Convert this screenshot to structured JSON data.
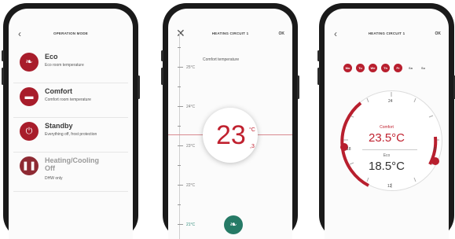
{
  "colors": {
    "accent": "#b81f2e",
    "eco_green": "#267a66",
    "phone_frame": "#1a1a1a"
  },
  "operation_mode": {
    "title": "OPERATION MODE",
    "back_icon": "chevron-left-icon",
    "modes": [
      {
        "name": "Eco",
        "description": "Eco room temperature",
        "icon": "leaf-icon"
      },
      {
        "name": "Comfort",
        "description": "Comfort room temperature",
        "icon": "bed-icon"
      },
      {
        "name": "Standby",
        "description": "Everything off, frost protection",
        "icon": "power-icon"
      },
      {
        "name": "Heating/Cooling Off",
        "description": "DHW only",
        "icon": "pause-icon"
      }
    ]
  },
  "heating_circuit_temp": {
    "title": "HEATING CIRCUIT 1",
    "ok": "OK",
    "close_icon": "close-icon",
    "label": "Comfort temperature",
    "scale": [
      "25°C",
      "24°C",
      "23°C",
      "22°C",
      "21°C"
    ],
    "temp_int": "23",
    "temp_unit": "°C",
    "temp_dec": ",3",
    "eco_button_icon": "leaf-icon"
  },
  "heating_circuit_schedule": {
    "title": "HEATING CIRCUIT 1",
    "ok": "OK",
    "back_icon": "chevron-left-icon",
    "days": [
      "Mo",
      "Tu",
      "We",
      "Th",
      "Fr",
      "Sa",
      "Su"
    ],
    "active_days": 5,
    "dial_labels": [
      "24",
      "6",
      "12",
      "18"
    ],
    "comfort_label": "Comfort",
    "comfort_value": "23.5°C",
    "eco_label": "Eco",
    "eco_value": "18.5°C"
  }
}
